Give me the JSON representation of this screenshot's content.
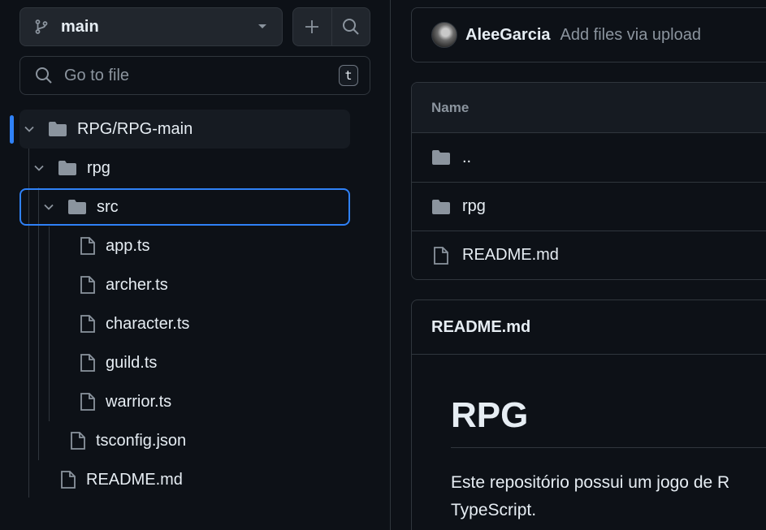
{
  "branch": {
    "name": "main"
  },
  "search": {
    "placeholder": "Go to file",
    "shortcut": "t"
  },
  "tree": {
    "root": "RPG/RPG-main",
    "folder_rpg": "rpg",
    "folder_src": "src",
    "src_files": [
      "app.ts",
      "archer.ts",
      "character.ts",
      "guild.ts",
      "warrior.ts"
    ],
    "rpg_file": "tsconfig.json",
    "root_file": "README.md"
  },
  "commit": {
    "author": "AleeGarcia",
    "message": "Add files via upload"
  },
  "files_table": {
    "header": "Name",
    "rows": [
      {
        "name": "..",
        "type": "folder"
      },
      {
        "name": "rpg",
        "type": "folder"
      },
      {
        "name": "README.md",
        "type": "file"
      }
    ]
  },
  "readme": {
    "title": "README.md",
    "heading": "RPG",
    "paragraph_line1": "Este repositório possui um jogo de R",
    "paragraph_line2": "TypeScript."
  },
  "colors": {
    "accent": "#2f81f7",
    "background": "#0d1117",
    "border": "#30363d",
    "muted_text": "#8b949e"
  },
  "icons": [
    "git-branch-icon",
    "chevron-down-icon",
    "plus-icon",
    "search-icon",
    "folder-icon",
    "file-icon",
    "avatar"
  ]
}
